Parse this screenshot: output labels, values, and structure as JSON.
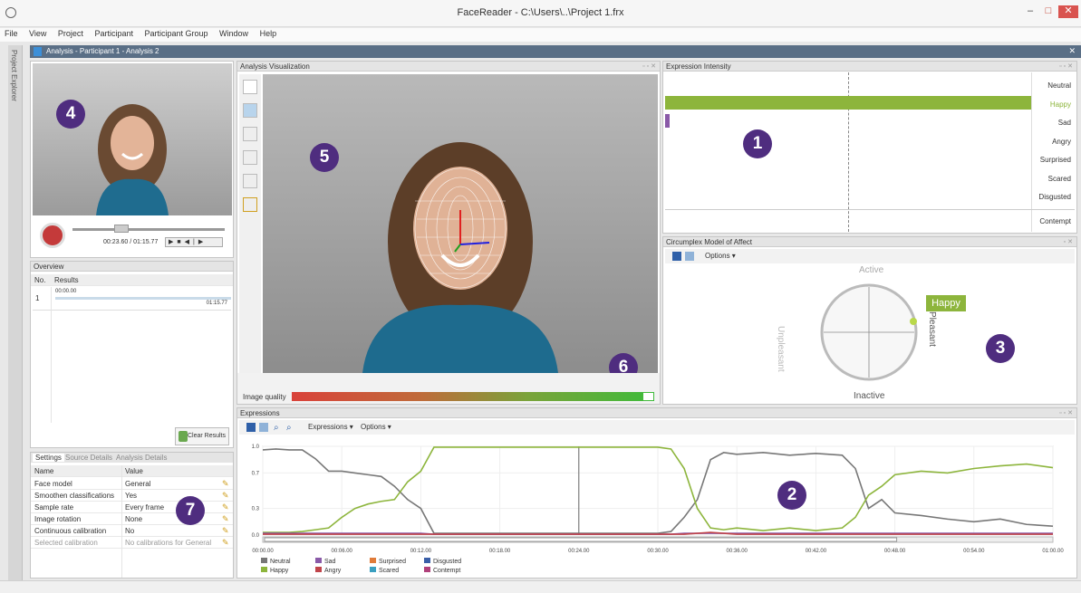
{
  "window": {
    "title": "FaceReader - C:\\Users\\..\\Project 1.frx",
    "minimize": "–",
    "maximize": "□",
    "close": "✕"
  },
  "menu": [
    "File",
    "View",
    "Project",
    "Participant",
    "Participant Group",
    "Window",
    "Help"
  ],
  "sidebar_label": "Project Explorer",
  "document_tab": "Analysis - Participant 1 - Analysis 2",
  "video": {
    "time": "00:23.60 / 01:15.77"
  },
  "overview": {
    "title": "Overview",
    "headers": [
      "No.",
      "Results"
    ],
    "row": {
      "no": "1",
      "start": "00:00.00",
      "end": "01:15.77"
    },
    "clear_button": "Clear Results"
  },
  "settings": {
    "tabs": [
      "Settings",
      "Source Details",
      "Analysis Details"
    ],
    "headers": [
      "Name",
      "Value"
    ],
    "rows": [
      {
        "name": "Face model",
        "value": "General"
      },
      {
        "name": "Smoothen classifications",
        "value": "Yes"
      },
      {
        "name": "Sample rate",
        "value": "Every frame"
      },
      {
        "name": "Image rotation",
        "value": "None"
      },
      {
        "name": "Continuous calibration",
        "value": "No"
      },
      {
        "name": "Selected calibration",
        "value": "No calibrations for General"
      }
    ]
  },
  "visualization": {
    "title": "Analysis Visualization",
    "image_quality_label": "Image quality"
  },
  "intensity": {
    "title": "Expression Intensity",
    "labels": [
      "Neutral",
      "Happy",
      "Sad",
      "Angry",
      "Surprised",
      "Scared",
      "Disgusted",
      "Contempt"
    ],
    "happy_color": "#8db53c"
  },
  "circumplex": {
    "title": "Circumplex Model of Affect",
    "options": "Options",
    "active": "Active",
    "inactive": "Inactive",
    "pleasant": "Pleasant",
    "unpleasant": "Unpleasant",
    "emotion": "Happy"
  },
  "expressions": {
    "title": "Expressions",
    "menu_expressions": "Expressions",
    "menu_options": "Options",
    "legend": [
      {
        "name": "Neutral",
        "color": "#777777"
      },
      {
        "name": "Happy",
        "color": "#8db53c"
      },
      {
        "name": "Sad",
        "color": "#8a5aa8"
      },
      {
        "name": "Angry",
        "color": "#c0444a"
      },
      {
        "name": "Surprised",
        "color": "#e07b39"
      },
      {
        "name": "Scared",
        "color": "#3a9fc0"
      },
      {
        "name": "Disgusted",
        "color": "#3a5fa8"
      },
      {
        "name": "Contempt",
        "color": "#b0407a"
      }
    ]
  },
  "chart_data": {
    "type": "line",
    "title": "",
    "xlabel": "",
    "ylabel": "",
    "ylim": [
      0,
      1.0
    ],
    "y_ticks": [
      "1.0",
      "0.7",
      "0.3",
      "0.0"
    ],
    "x_ticks": [
      "00:00.00",
      "00:06.00",
      "00:12.00",
      "00:18.00",
      "00:24.00",
      "00:30.00",
      "00:36.00",
      "00:42.00",
      "00:48.00",
      "00:54.00",
      "01:00.00"
    ],
    "x_seconds": [
      0,
      1,
      2,
      3,
      4,
      5,
      6,
      7,
      8,
      9,
      10,
      11,
      12,
      13,
      14,
      16,
      18,
      20,
      22,
      24,
      26,
      28,
      30,
      31,
      32,
      33,
      34,
      35,
      36,
      38,
      40,
      42,
      44,
      45,
      46,
      47,
      48,
      50,
      52,
      54,
      56,
      58,
      60
    ],
    "series": [
      {
        "name": "Neutral",
        "color": "#777777",
        "values": [
          0.96,
          0.97,
          0.96,
          0.96,
          0.86,
          0.72,
          0.72,
          0.7,
          0.68,
          0.66,
          0.55,
          0.4,
          0.3,
          0.02,
          0.02,
          0.02,
          0.02,
          0.02,
          0.02,
          0.02,
          0.02,
          0.02,
          0.02,
          0.04,
          0.2,
          0.4,
          0.85,
          0.93,
          0.91,
          0.93,
          0.9,
          0.92,
          0.9,
          0.75,
          0.3,
          0.4,
          0.25,
          0.22,
          0.18,
          0.15,
          0.18,
          0.12,
          0.1
        ]
      },
      {
        "name": "Happy",
        "color": "#8db53c",
        "values": [
          0.03,
          0.03,
          0.03,
          0.04,
          0.06,
          0.08,
          0.2,
          0.3,
          0.35,
          0.38,
          0.4,
          0.6,
          0.72,
          0.99,
          0.99,
          0.99,
          0.99,
          0.99,
          0.99,
          0.99,
          0.99,
          0.99,
          0.99,
          0.97,
          0.75,
          0.3,
          0.08,
          0.06,
          0.08,
          0.05,
          0.08,
          0.05,
          0.08,
          0.2,
          0.45,
          0.55,
          0.68,
          0.72,
          0.7,
          0.75,
          0.78,
          0.8,
          0.76
        ]
      },
      {
        "name": "Sad",
        "color": "#8a5aa8",
        "values": [
          0.02,
          0.02,
          0.02,
          0.02,
          0.02,
          0.02,
          0.02,
          0.02,
          0.02,
          0.02,
          0.02,
          0.02,
          0.02,
          0.01,
          0.01,
          0.01,
          0.01,
          0.01,
          0.01,
          0.01,
          0.01,
          0.01,
          0.01,
          0.01,
          0.02,
          0.02,
          0.02,
          0.02,
          0.02,
          0.02,
          0.02,
          0.02,
          0.02,
          0.02,
          0.02,
          0.02,
          0.02,
          0.02,
          0.02,
          0.02,
          0.02,
          0.02,
          0.02
        ]
      },
      {
        "name": "Angry",
        "color": "#c0444a",
        "values": [
          0.01,
          0.01,
          0.01,
          0.01,
          0.01,
          0.01,
          0.01,
          0.01,
          0.01,
          0.01,
          0.01,
          0.01,
          0.01,
          0.01,
          0.01,
          0.01,
          0.01,
          0.01,
          0.01,
          0.01,
          0.01,
          0.01,
          0.01,
          0.01,
          0.01,
          0.02,
          0.03,
          0.02,
          0.01,
          0.01,
          0.01,
          0.01,
          0.01,
          0.01,
          0.01,
          0.01,
          0.01,
          0.01,
          0.01,
          0.01,
          0.01,
          0.01,
          0.01
        ]
      }
    ]
  }
}
